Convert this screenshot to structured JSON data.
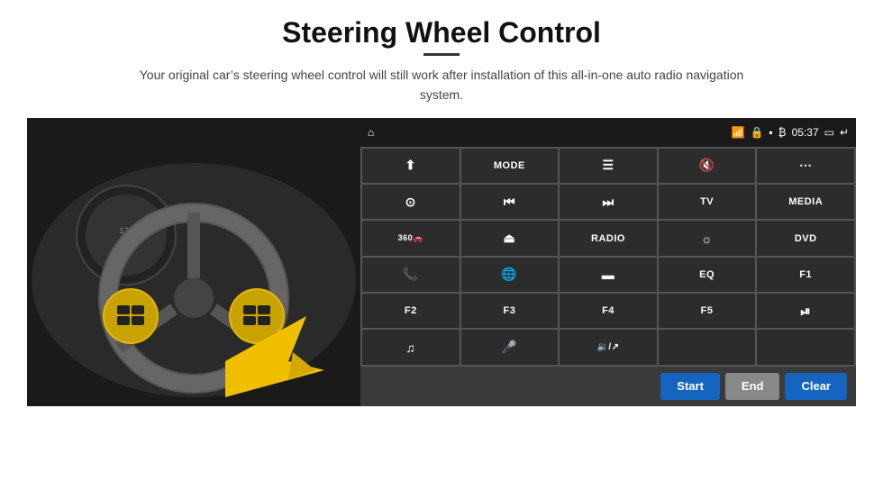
{
  "page": {
    "title": "Steering Wheel Control",
    "subtitle": "Your original car’s steering wheel control will still work after installation of this all-in-one auto radio navigation system.",
    "title_underline": true
  },
  "status_bar": {
    "wifi_icon": "▾",
    "time": "05:37",
    "home_icon": "⌂",
    "back_icon": "↵",
    "lock_icon": "🔒",
    "bluetooth_icon": "⧔"
  },
  "grid_buttons": [
    {
      "label": "",
      "icon": "←",
      "row": 1,
      "col": 1
    },
    {
      "label": "MODE",
      "icon": "",
      "row": 1,
      "col": 2
    },
    {
      "label": "",
      "icon": "☰",
      "row": 1,
      "col": 3
    },
    {
      "label": "",
      "icon": "🔇",
      "row": 1,
      "col": 4
    },
    {
      "label": "",
      "icon": "⋮⋮",
      "row": 1,
      "col": 5
    },
    {
      "label": "",
      "icon": "⊙",
      "row": 2,
      "col": 1
    },
    {
      "label": "",
      "icon": "⏮",
      "row": 2,
      "col": 2
    },
    {
      "label": "",
      "icon": "⏭",
      "row": 2,
      "col": 3
    },
    {
      "label": "TV",
      "icon": "",
      "row": 2,
      "col": 4
    },
    {
      "label": "MEDIA",
      "icon": "",
      "row": 2,
      "col": 5
    },
    {
      "label": "360",
      "icon": "🚗",
      "row": 3,
      "col": 1
    },
    {
      "label": "",
      "icon": "⏫",
      "row": 3,
      "col": 2
    },
    {
      "label": "RADIO",
      "icon": "",
      "row": 3,
      "col": 3
    },
    {
      "label": "",
      "icon": "☀",
      "row": 3,
      "col": 4
    },
    {
      "label": "DVD",
      "icon": "",
      "row": 3,
      "col": 5
    },
    {
      "label": "",
      "icon": "📞",
      "row": 4,
      "col": 1
    },
    {
      "label": "",
      "icon": "➿",
      "row": 4,
      "col": 2
    },
    {
      "label": "",
      "icon": "━━",
      "row": 4,
      "col": 3
    },
    {
      "label": "EQ",
      "icon": "",
      "row": 4,
      "col": 4
    },
    {
      "label": "F1",
      "icon": "",
      "row": 4,
      "col": 5
    },
    {
      "label": "F2",
      "icon": "",
      "row": 5,
      "col": 1
    },
    {
      "label": "F3",
      "icon": "",
      "row": 5,
      "col": 2
    },
    {
      "label": "F4",
      "icon": "",
      "row": 5,
      "col": 3
    },
    {
      "label": "F5",
      "icon": "",
      "row": 5,
      "col": 4
    },
    {
      "label": "",
      "icon": "⏯",
      "row": 5,
      "col": 5
    },
    {
      "label": "",
      "icon": "♫",
      "row": 6,
      "col": 1
    },
    {
      "label": "",
      "icon": "🎤",
      "row": 6,
      "col": 2
    },
    {
      "label": "",
      "icon": "🔉/↗",
      "row": 6,
      "col": 3
    },
    {
      "label": "",
      "icon": "",
      "row": 6,
      "col": 4
    },
    {
      "label": "",
      "icon": "",
      "row": 6,
      "col": 5
    }
  ],
  "bottom_buttons": {
    "start_label": "Start",
    "end_label": "End",
    "clear_label": "Clear"
  }
}
